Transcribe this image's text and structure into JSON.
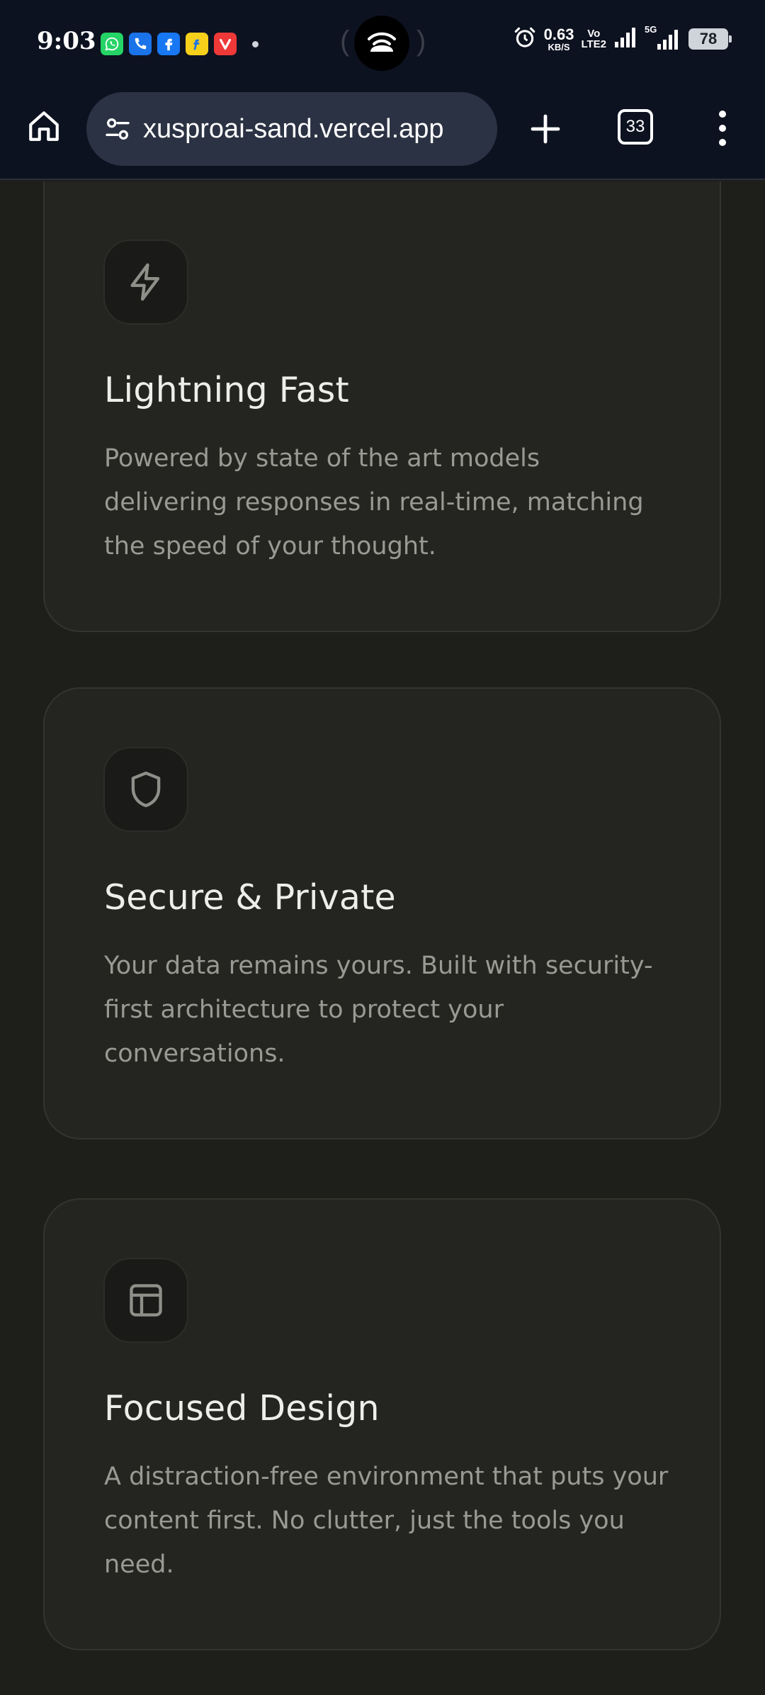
{
  "status_bar": {
    "time": "9:03",
    "notification_icons": [
      {
        "icon": "whatsapp-icon",
        "glyph": "✆",
        "color": "#25d366"
      },
      {
        "icon": "phone-app-icon",
        "glyph": "✆",
        "color": "#1a73e8"
      },
      {
        "icon": "facebook-icon",
        "glyph": "f",
        "color": "#1877f2"
      },
      {
        "icon": "flipkart-icon",
        "glyph": "f",
        "color": "#f7d01c"
      },
      {
        "icon": "vivaldi-icon",
        "glyph": "V",
        "color": "#ef3939"
      }
    ],
    "net_speed_value": "0.63",
    "net_speed_unit": "KB/S",
    "volte_top": "Vo",
    "volte_bottom": "LTE2",
    "network_5g": "5G",
    "battery": "78"
  },
  "browser": {
    "url": "xusproai-sand.vercel.app",
    "tab_count": "33"
  },
  "features": [
    {
      "icon": "lightning-icon",
      "title": "Lightning Fast",
      "description": "Powered by state of the art models delivering responses in real-time, matching the speed of your thought."
    },
    {
      "icon": "shield-icon",
      "title": "Secure & Private",
      "description": "Your data remains yours. Built with security-first architecture to protect your conversations."
    },
    {
      "icon": "layout-icon",
      "title": "Focused Design",
      "description": "A distraction-free environment that puts your content first. No clutter, just the tools you need."
    }
  ],
  "colors": {
    "status_bg": "#0d1220",
    "page_bg": "#1e1e1b",
    "card_bg": "#242421",
    "title": "#ededea",
    "description": "#9a9a94",
    "icon_stroke": "#8f8f89"
  }
}
